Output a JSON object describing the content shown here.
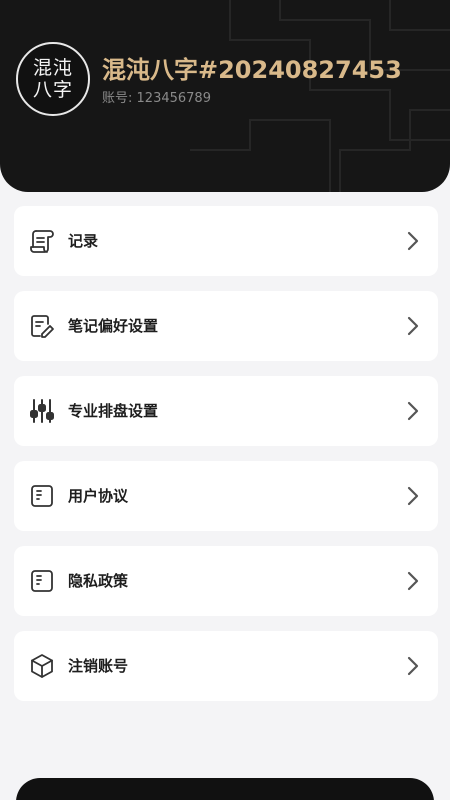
{
  "profile": {
    "avatar_text_line1": "混沌",
    "avatar_text_line2": "八字",
    "username": "混沌八字#20240827453",
    "account_label": "账号:",
    "account_number": "123456789"
  },
  "menu": [
    {
      "label": "记录",
      "icon": "scroll-icon"
    },
    {
      "label": "笔记偏好设置",
      "icon": "edit-note-icon"
    },
    {
      "label": "专业排盘设置",
      "icon": "sliders-icon"
    },
    {
      "label": "用户协议",
      "icon": "document-icon"
    },
    {
      "label": "隐私政策",
      "icon": "document-icon"
    },
    {
      "label": "注销账号",
      "icon": "cube-icon"
    }
  ],
  "colors": {
    "header_bg": "#161616",
    "username_gold": "#d9b98a",
    "page_bg": "#f4f4f6",
    "card_bg": "#ffffff"
  }
}
